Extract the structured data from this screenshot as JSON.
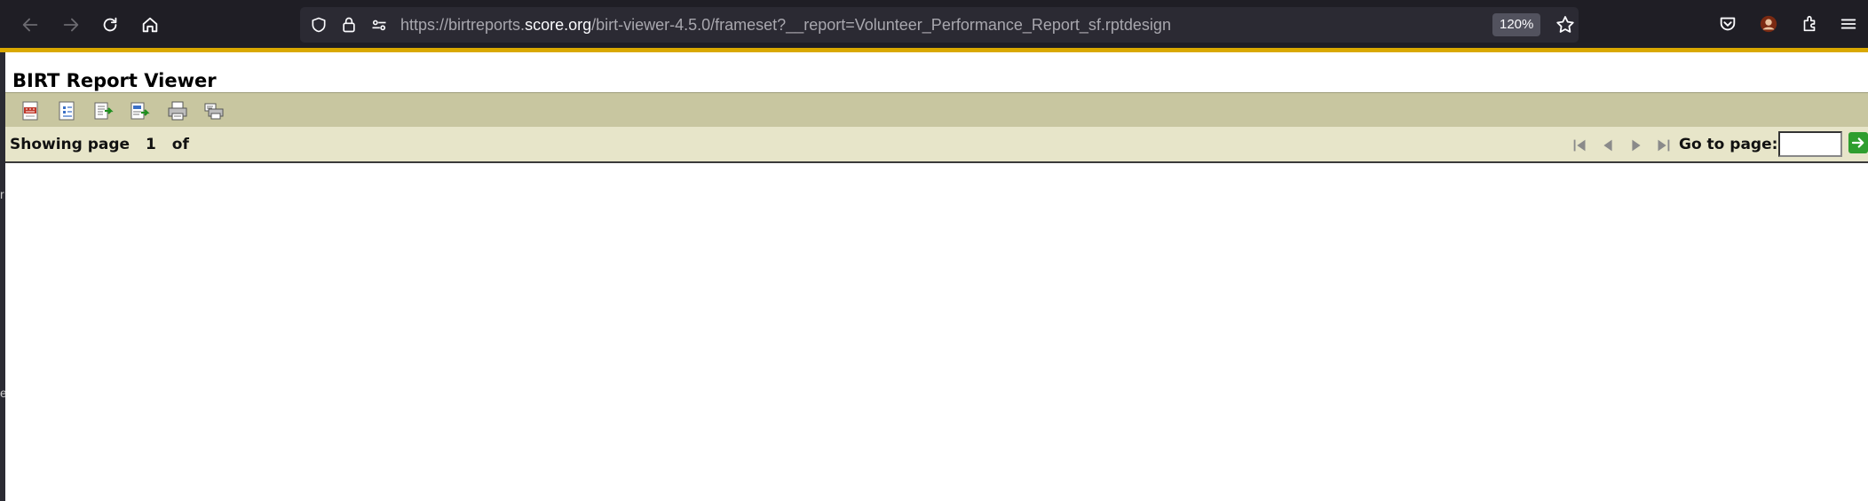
{
  "browser": {
    "url_prefix": "https://birtreports.",
    "url_domain": "score.org",
    "url_path": "/birt-viewer-4.5.0/frameset?__report=Volunteer_Performance_Report_sf.rptdesign",
    "zoom": "120%",
    "nav_icons": [
      "back-arrow-icon",
      "forward-arrow-icon",
      "reload-icon",
      "home-icon"
    ],
    "url_icons": [
      "shield-icon",
      "lock-icon",
      "permissions-icon"
    ],
    "right_icons": [
      "pocket-icon",
      "account-avatar-icon",
      "extensions-icon",
      "menu-icon"
    ],
    "accent_color": "#d9a800"
  },
  "viewer": {
    "title": "BIRT Report Viewer",
    "toolbar": [
      {
        "name": "toc-icon"
      },
      {
        "name": "parameters-icon"
      },
      {
        "name": "export-data-icon"
      },
      {
        "name": "export-report-icon"
      },
      {
        "name": "print-icon"
      },
      {
        "name": "print-server-icon"
      }
    ],
    "navbar": {
      "showing_label": "Showing page",
      "current_page": "1",
      "of_label": "of",
      "total_pages": "",
      "goto_label": "Go to page:",
      "goto_value": "",
      "buttons": [
        "first-page-icon",
        "previous-page-icon",
        "next-page-icon",
        "last-page-icon",
        "go-icon"
      ]
    },
    "colors": {
      "toolbar_bg": "#c8c6a0",
      "navbar_bg": "#e7e5c9"
    }
  }
}
